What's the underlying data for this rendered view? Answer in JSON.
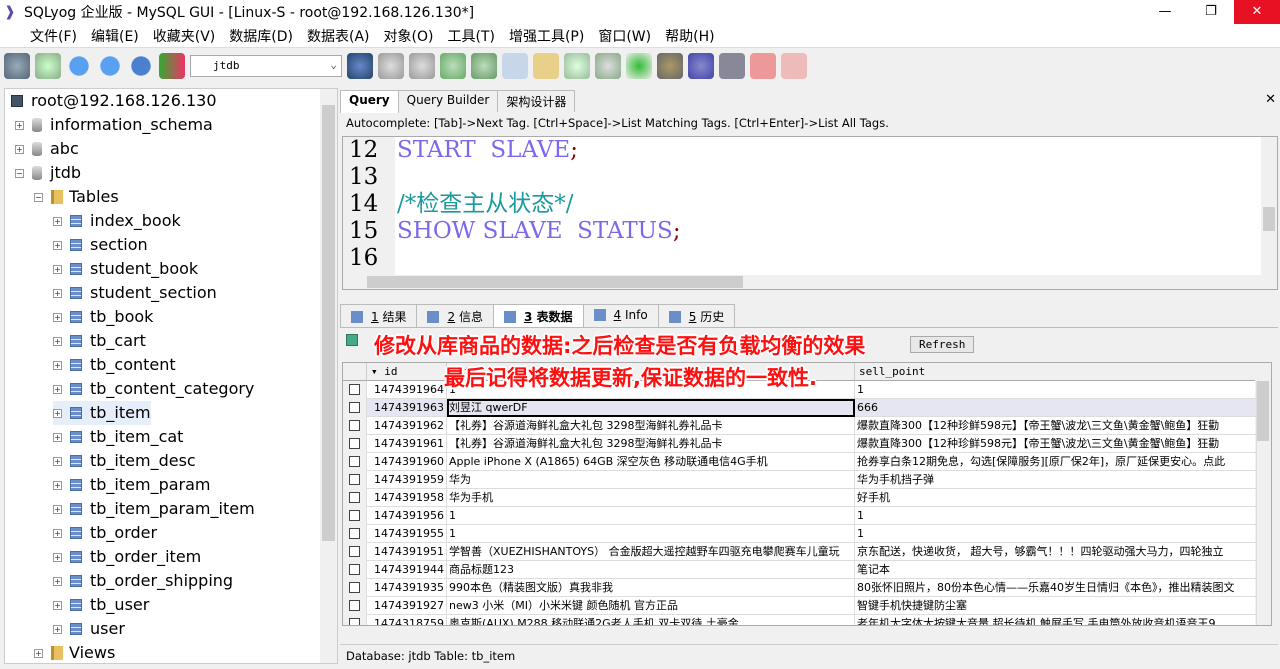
{
  "window": {
    "title": "SQLyog 企业版 - MySQL GUI - [Linux-S - root@192.168.126.130*]",
    "min": "—",
    "restore": "❐",
    "close": "✕"
  },
  "menu": [
    "文件(F)",
    "编辑(E)",
    "收藏夹(V)",
    "数据库(D)",
    "数据表(A)",
    "对象(O)",
    "工具(T)",
    "增强工具(P)",
    "窗口(W)",
    "帮助(H)"
  ],
  "toolbar": {
    "database_select": "jtdb"
  },
  "tree": {
    "connection": "root@192.168.126.130",
    "databases": [
      "information_schema",
      "abc",
      "jtdb"
    ],
    "folder": "Tables",
    "tables": [
      "index_book",
      "section",
      "student_book",
      "student_section",
      "tb_book",
      "tb_cart",
      "tb_content",
      "tb_content_category",
      "tb_item",
      "tb_item_cat",
      "tb_item_desc",
      "tb_item_param",
      "tb_item_param_item",
      "tb_order",
      "tb_order_item",
      "tb_order_shipping",
      "tb_user",
      "user"
    ],
    "views": "Views"
  },
  "query_tabs": [
    "Query",
    "Query Builder",
    "架构设计器"
  ],
  "autocomplete": "Autocomplete: [Tab]->Next Tag. [Ctrl+Space]->List Matching Tags. [Ctrl+Enter]->List All Tags.",
  "editor": {
    "lines": [
      {
        "n": "12",
        "parts": [
          {
            "t": "START  SLAVE",
            "c": "kw"
          },
          {
            "t": ";",
            "c": "semi"
          }
        ]
      },
      {
        "n": "13",
        "parts": []
      },
      {
        "n": "14",
        "parts": [
          {
            "t": "/*检查主从状态*/",
            "c": "cm"
          }
        ]
      },
      {
        "n": "15",
        "parts": [
          {
            "t": "SHOW SLAVE  STATUS",
            "c": "kw"
          },
          {
            "t": ";",
            "c": "semi"
          }
        ]
      },
      {
        "n": "16",
        "parts": []
      }
    ]
  },
  "result_tabs": [
    {
      "num": "1",
      "label": "结果"
    },
    {
      "num": "2",
      "label": "信息"
    },
    {
      "num": "3",
      "label": "表数据"
    },
    {
      "num": "4",
      "label": "Info"
    },
    {
      "num": "5",
      "label": "历史"
    }
  ],
  "grid_toolbar": {
    "refresh": "Refresh"
  },
  "overlay": {
    "line1": "修改从库商品的数据:之后检查是否有负载均衡的效果",
    "line2": "最后记得将数据更新,保证数据的一致性."
  },
  "grid": {
    "columns": [
      "id",
      "title",
      "sell_point"
    ],
    "rows": [
      [
        "1474391964",
        "1",
        "1"
      ],
      [
        "1474391963",
        "刘昱江 qwerDF",
        "666"
      ],
      [
        "1474391962",
        "【礼券】谷源道海鲜礼盒大礼包 3298型海鲜礼券礼品卡",
        "爆款直降300【12种珍鲜598元】【帝王蟹\\波龙\\三文鱼\\黄金蟹\\鲍鱼】狂勸"
      ],
      [
        "1474391961",
        "【礼券】谷源道海鲜礼盒大礼包 3298型海鲜礼券礼品卡",
        "爆款直降300【12种珍鲜598元】【帝王蟹\\波龙\\三文鱼\\黄金蟹\\鲍鱼】狂勸"
      ],
      [
        "1474391960",
        "Apple iPhone X (A1865) 64GB 深空灰色 移动联通电信4G手机",
        "抢券享白条12期免息，勾选[保障服务][原厂保2年]，原厂延保更安心。点此"
      ],
      [
        "1474391959",
        "华为",
        "华为手机挡子弹"
      ],
      [
        "1474391958",
        "华为手机",
        "好手机"
      ],
      [
        "1474391956",
        "1",
        "1"
      ],
      [
        "1474391955",
        "1",
        "1"
      ],
      [
        "1474391951",
        "学智善（XUEZHISHANTOYS） 合金版超大遥控越野车四驱充电攀爬赛车儿童玩",
        "京东配送，快递收货， 超大号，够霸气！！！四轮驱动强大马力，四轮独立"
      ],
      [
        "1474391944",
        "商品标题123",
        "笔记本"
      ],
      [
        "1474391935",
        "990本色（精装图文版）真我非我",
        "80张怀旧照片，80份本色心情——乐嘉40岁生日情归《本色》，推出精装图文"
      ],
      [
        "1474391927",
        "new3 小米（MI）小米米键 颜色随机 官方正品",
        "智键手机快捷键防尘塞"
      ],
      [
        "1474318759",
        "奥克斯(AUX) M288 移动联通2G老人手机 双卡双待 土豪金",
        "老年机大字体大按键大音量 超长待机 触屏手写 手电筒外放收音机语音王9"
      ]
    ]
  },
  "status": "Database: jtdb Table: tb_item"
}
